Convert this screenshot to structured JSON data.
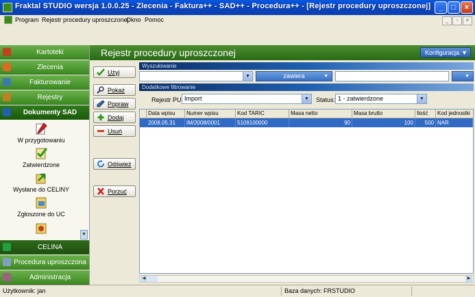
{
  "window": {
    "title": "Fraktal STUDIO  wersja 1.0.0.25 - Zlecenia - Faktura++ - SAD++ - Procedura++ - [Rejestr procedury uproszczonej]"
  },
  "menu": [
    "Program",
    "Rejestr procedury uproszczonej",
    "Okno",
    "Pomoc"
  ],
  "sidebar": {
    "sections": [
      {
        "label": "Kartoteki",
        "color": "#c04020"
      },
      {
        "label": "Zlecenia",
        "color": "#e06a20"
      },
      {
        "label": "Fakturowanie",
        "color": "#3a7ab0"
      },
      {
        "label": "Rejestry",
        "color": "#c08020"
      },
      {
        "label": "Dokumenty SAD",
        "color": "#2060b0"
      }
    ],
    "items": [
      {
        "label": "W przygotowaniu",
        "icon": "red-pen-document-icon"
      },
      {
        "label": "Zatwierdzone",
        "icon": "check-document-icon"
      },
      {
        "label": "Wysłane do CELINY",
        "icon": "send-arrow-icon"
      },
      {
        "label": "Zgłoszone do UC",
        "icon": "uc-document-icon"
      }
    ],
    "bottom_sections": [
      {
        "label": "CELINA",
        "color": "#20a040"
      },
      {
        "label": "Procedura uproszczona",
        "color": "#80a0c0"
      },
      {
        "label": "Administracja",
        "color": "#a06080"
      }
    ]
  },
  "main": {
    "title": "Rejestr procedury uproszczonej",
    "config_button": "Konfiguracja",
    "search_section": "Wyszukiwanie",
    "search_mode": "zawiera",
    "filters_section": "Dodatkowe filtrowanie",
    "registry_label": "Rejestr PU:",
    "registry_value": "Import",
    "status_label": "Status:",
    "status_value": "1 - zatwierdzone"
  },
  "buttons": {
    "use": "Użyj",
    "show": "Pokaż",
    "edit": "Popraw",
    "add": "Dodaj",
    "delete": "Usuń",
    "refresh": "Odśwież",
    "abandon": "Porzuć"
  },
  "grid": {
    "columns": [
      "Data wpisu",
      "Numer wpisu",
      "Kod TARIC",
      "Masa netto",
      "Masa brutto",
      "Ilość",
      "Kod jednostki"
    ],
    "rows": [
      [
        "2008.05.31",
        "IM/2008/0001",
        "5109100000",
        "90",
        "100",
        "500",
        "NAR"
      ]
    ]
  },
  "status": {
    "user": "Użytkownik: jan",
    "database": "Baza danych: FRSTUDIO"
  },
  "colors": {
    "accent_green": "#3d8a22",
    "title_blue": "#0a58e0",
    "selection_blue": "#316ac5"
  }
}
